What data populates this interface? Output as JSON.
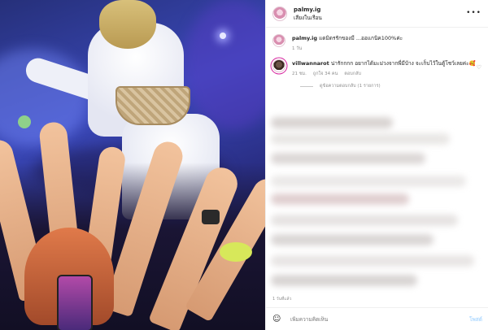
{
  "post": {
    "username": "palmy.ig",
    "location": "เสียงในเรือน",
    "caption_username": "palmy.ig",
    "caption_text": "แดมิดรรักของมี ...ออแกนิค100%ค่ะ",
    "caption_time": "1 วัน"
  },
  "comment": {
    "username": "villwannarot",
    "text": "น่ารักกกก อยากได้มะม่วงจากพี่มีบ้าง จะเก็บไว้ในตู้โชว์เลยค่ะ🥰",
    "time": "21 ชม.",
    "likes": "ถูกใจ 34 คน",
    "reply": "ตอบกลับ",
    "view_replies": "ดูข้อความตอบกลับ (1 รายการ)"
  },
  "footer": {
    "date": "1 วันที่แล้ว",
    "placeholder": "เพิ่มความคิดเห็น",
    "post_label": "โพสต์"
  },
  "icons": {
    "more": "more-options-icon",
    "heart": "heart-icon",
    "emoji": "emoji-icon"
  },
  "colors": {
    "post_button": "#b3dbff",
    "meta_gray": "#8e8e8e",
    "story_ring": "#d6249f"
  }
}
